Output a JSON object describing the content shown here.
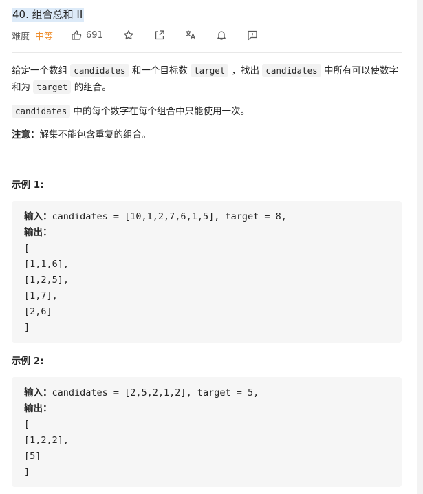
{
  "problem": {
    "title": "40. 组合总和 II",
    "difficulty_label": "难度",
    "difficulty_value": "中等",
    "likes": "691"
  },
  "icons": [
    "thumbs-up-icon",
    "star-icon",
    "share-icon",
    "translate-icon",
    "bell-icon",
    "feedback-icon"
  ],
  "description": {
    "p1_a": "给定一个数组 ",
    "p1_code1": "candidates",
    "p1_b": " 和一个目标数 ",
    "p1_code2": "target",
    "p1_c": " ，找出 ",
    "p1_code3": "candidates",
    "p1_d": " 中所有可以使数字和为 ",
    "p1_code4": "target",
    "p1_e": " 的组合。",
    "p2_code": "candidates",
    "p2_text": " 中的每个数字在每个组合中只能使用一次。",
    "note_label": "注意：",
    "note_text": "解集不能包含重复的组合。"
  },
  "examples": [
    {
      "title": "示例 1:",
      "input_label": "输入：",
      "input": "candidates = [10,1,2,7,6,1,5], target = 8,",
      "output_label": "输出：",
      "output_lines": [
        "[",
        "[1,1,6],",
        "[1,2,5],",
        "[1,7],",
        "[2,6]",
        "]"
      ]
    },
    {
      "title": "示例 2:",
      "input_label": "输入：",
      "input": "candidates = [2,5,2,1,2], target = 5,",
      "output_label": "输出：",
      "output_lines": [
        "[",
        "[1,2,2],",
        "[5]",
        "]"
      ]
    }
  ]
}
